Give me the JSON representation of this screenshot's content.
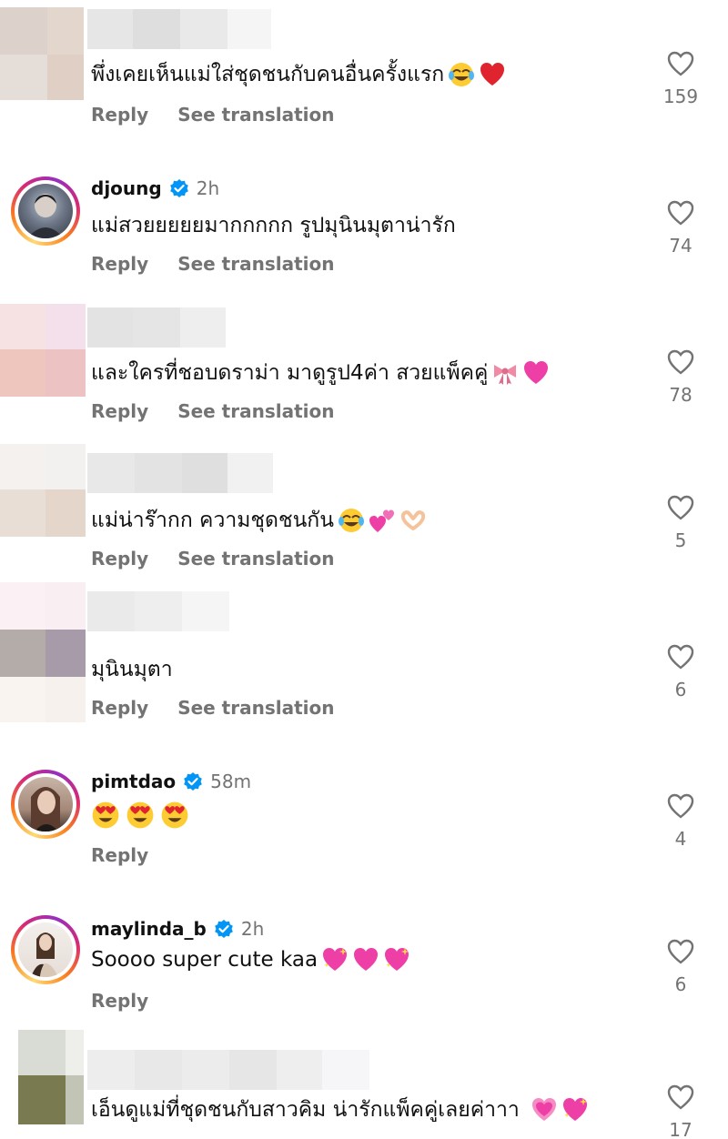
{
  "labels": {
    "reply": "Reply",
    "see_translation": "See translation"
  },
  "comments": [
    {
      "username": "",
      "time": "",
      "text": "พึ่งเคยเห็นแม่ใส่ชุดชนกับคนอื่นครั้งแรก",
      "emojis": [
        "joy",
        "red-heart"
      ],
      "likes": "159",
      "translation": true
    },
    {
      "username": "djoung",
      "time": "2h",
      "text": "แม่สวยยยยยมากกกกก รูปมุนินมุตาน่ารัก",
      "emojis": [],
      "likes": "74",
      "translation": true
    },
    {
      "username": "",
      "time": "",
      "text": "และใครที่ชอบดราม่า มาดูรูป4ค่า สวยแพ็คคู่",
      "emojis": [
        "ribbon",
        "pink-heart"
      ],
      "likes": "78",
      "translation": true
    },
    {
      "username": "",
      "time": "",
      "text": "แม่น่าร๊ากก ความชุดชนกัน",
      "emojis": [
        "joy",
        "two-hearts",
        "heart-hands"
      ],
      "likes": "5",
      "translation": true
    },
    {
      "username": "",
      "time": "",
      "text": "มุนินมุตา",
      "emojis": [],
      "likes": "6",
      "translation": true
    },
    {
      "username": "pimtdao",
      "time": "58m",
      "text": "",
      "emojis": [
        "heart-eyes",
        "heart-eyes",
        "heart-eyes"
      ],
      "likes": "4",
      "translation": false
    },
    {
      "username": "maylinda_b",
      "time": "2h",
      "text": "Soooo super cute kaa",
      "emojis": [
        "sparkling-heart",
        "pink-heart",
        "sparkling-heart"
      ],
      "likes": "6",
      "translation": false
    },
    {
      "username": "",
      "time": "",
      "text": "เอ็นดูแม่ที่ชุดชนกับสาวคิม น่ารักแพ็คคู่เลยค่าาา",
      "emojis": [
        "growing-heart",
        "sparkling-heart"
      ],
      "likes": "17",
      "translation": false
    }
  ],
  "colors": {
    "verified": "#0095f6",
    "muted": "#737373",
    "text": "#111111"
  }
}
